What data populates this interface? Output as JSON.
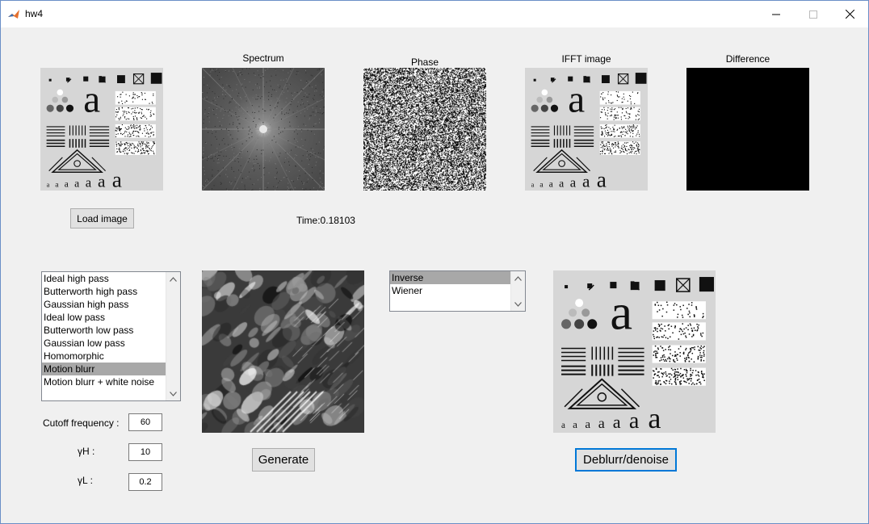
{
  "window": {
    "title": "hw4"
  },
  "panels": {
    "spectrum_title": "Spectrum",
    "phase_title": "Phase",
    "ifft_title": "IFFT image",
    "difference_title": "Difference"
  },
  "controls": {
    "load_image_label": "Load image",
    "time_text": "Time:0.18103",
    "generate_label": "Generate",
    "deblur_label": "Deblurr/denoise"
  },
  "filter_list": {
    "items": [
      "Ideal high pass",
      "Butterworth high pass",
      "Gaussian high pass",
      "Ideal low pass",
      "Butterworth low pass",
      "Gaussian low pass",
      "Homomorphic",
      "Motion blurr",
      "Motion blurr + white noise"
    ],
    "selected": "Motion blurr"
  },
  "restore_list": {
    "items": [
      "Inverse",
      "Wiener"
    ],
    "selected": "Inverse"
  },
  "params": {
    "cutoff_label": "Cutoff frequency :",
    "cutoff_value": "60",
    "gamma_h_label": "γH :",
    "gamma_h_value": "10",
    "gamma_l_label": "γL :",
    "gamma_l_value": "0.2"
  },
  "test_pattern": {
    "letter": "a"
  }
}
